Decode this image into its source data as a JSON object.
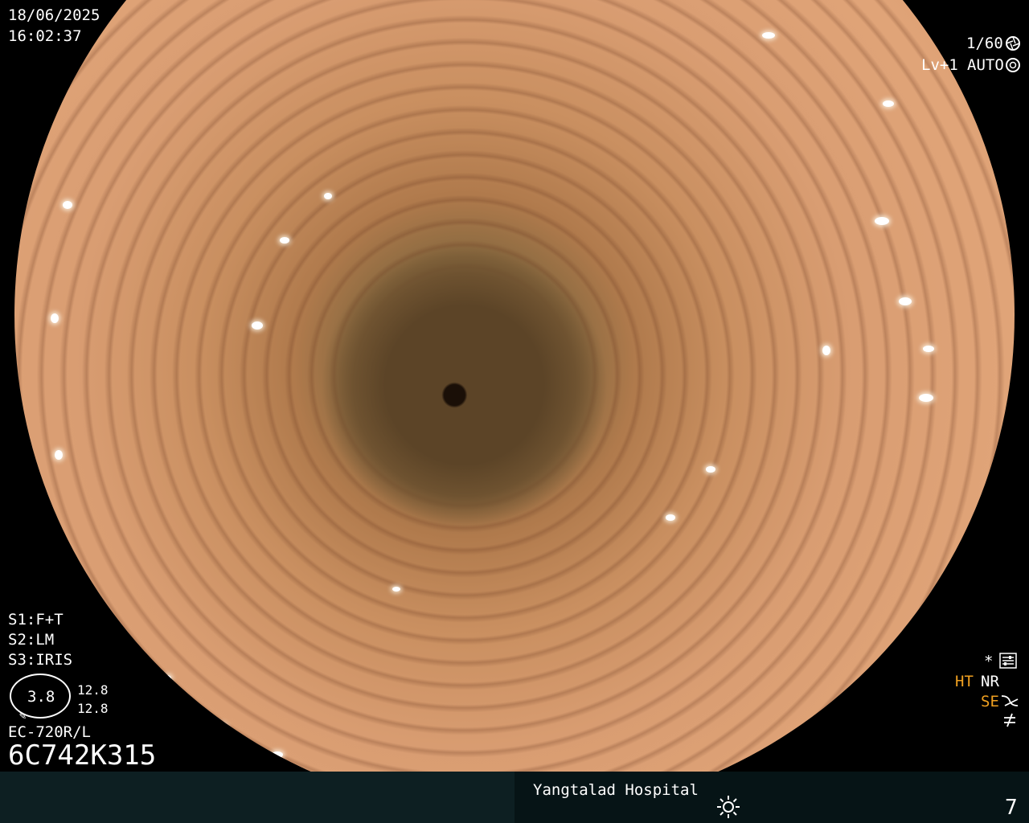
{
  "overlay": {
    "date": "18/06/2025",
    "time": "16:02:37",
    "shutter": "1/60",
    "level": "Lv+1",
    "mode": "AUTO",
    "s1": "S1:F+T",
    "s2": "S2:LM",
    "s3": "S3:IRIS",
    "gauge_value": "3.8",
    "gauge_top": "12.8",
    "gauge_bottom": "12.8",
    "scope_model": "EC-720R/L",
    "serial": "6C742K315",
    "star_icon": "*",
    "ht_label": "HT",
    "nr_label": "NR",
    "se_label": "SE",
    "hospital": "Yangtalad Hospital",
    "page_number": "7"
  },
  "colors": {
    "accent_orange": "#f0a020",
    "bottom_bar": "#0d1f22"
  },
  "icons": [
    "shutter-icon",
    "aperture-icon",
    "settings-icon",
    "sun-icon",
    "curve-icon",
    "slash-icon"
  ]
}
